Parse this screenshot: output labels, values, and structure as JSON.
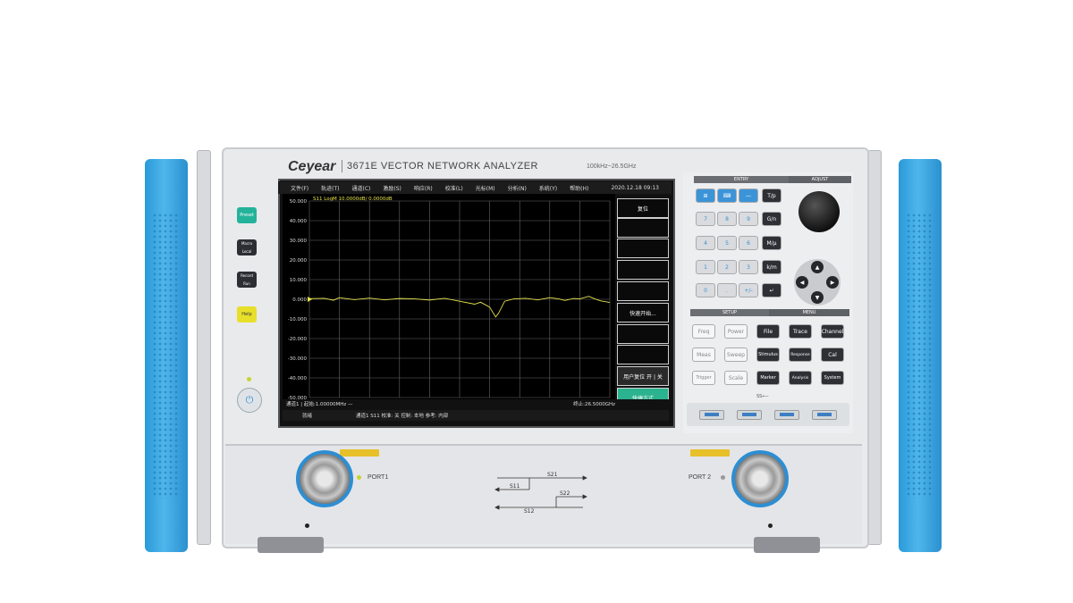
{
  "device": {
    "brand": "Ceyear",
    "model": "3671E VECTOR NETWORK ANALYZER",
    "freq_range": "100kHz~26.5GHz"
  },
  "side_buttons": {
    "preset": "Preset",
    "macro_local": "Macro Local",
    "record_run": "Record Run",
    "help": "Help"
  },
  "screen": {
    "menu": [
      "文件(F)",
      "轨迹(T)",
      "通道(C)",
      "激励(S)",
      "响应(R)",
      "校准(L)",
      "光标(M)",
      "分析(N)",
      "系统(Y)",
      "帮助(H)"
    ],
    "datetime": "2020.12.18 09:13",
    "trace_label": "S11 LogM 10.0000dB/ 0.0000dB",
    "y_ticks": [
      "50.000",
      "40.000",
      "30.000",
      "20.000",
      "10.000",
      "0.000",
      "-10.000",
      "-20.000",
      "-30.000",
      "-40.000",
      "-50.000"
    ],
    "softkeys": [
      "复位",
      "",
      "",
      "",
      "",
      "快速开始...",
      "",
      "",
      "用户复位 开 | 关",
      "快捷方式"
    ],
    "status_top": "通道1 | 起始:1.00000MHz —",
    "status_stop": "终止:26.5000GHz",
    "status_left": "就绪",
    "status_mid": "通道1  S11  校准: 关  控制: 本地  参考: 内部"
  },
  "keypad": {
    "entry_label": "ENTRY",
    "adjust_label": "ADJUST",
    "setup_label": "SETUP",
    "menu_label": "MENU",
    "entry_keys": [
      "T/p",
      "G/n",
      "M/μ",
      "k/m",
      "7",
      "8",
      "9",
      "4",
      "5",
      "6",
      "1",
      "2",
      "3",
      "0",
      "."
    ],
    "setup_keys": [
      "Freq",
      "Power",
      "Meas",
      "Sweep",
      "Trigger",
      "Scale"
    ],
    "menu_keys": [
      "File",
      "Trace",
      "Channel",
      "Stimulus",
      "Response",
      "Cal",
      "Marker",
      "Analysis",
      "System"
    ],
    "usb_label": "SS⟵"
  },
  "ports": {
    "port1": "PORT1",
    "port2": "PORT 2",
    "diagram": {
      "s21": "S21",
      "s11": "S11",
      "s22": "S22",
      "s12": "S12"
    }
  },
  "chart_data": {
    "type": "line",
    "ylabel": "",
    "ylim": [
      -50,
      50
    ],
    "xlim": [
      0,
      100
    ],
    "grid": true,
    "series": [
      {
        "values": [
          [
            0,
            0.3
          ],
          [
            5,
            0.5
          ],
          [
            8,
            -0.5
          ],
          [
            10,
            0.8
          ],
          [
            15,
            -0.2
          ],
          [
            20,
            0.6
          ],
          [
            25,
            -0.3
          ],
          [
            30,
            0.4
          ],
          [
            35,
            0.2
          ],
          [
            40,
            -0.4
          ],
          [
            45,
            0.5
          ],
          [
            50,
            -1.0
          ],
          [
            55,
            -2.5
          ],
          [
            57,
            -1.5
          ],
          [
            60,
            -4.0
          ],
          [
            62,
            -9.0
          ],
          [
            63,
            -7.0
          ],
          [
            65,
            -1.0
          ],
          [
            68,
            0.2
          ],
          [
            72,
            0.5
          ],
          [
            76,
            -0.3
          ],
          [
            80,
            0.8
          ],
          [
            83,
            0.2
          ],
          [
            85,
            -0.6
          ],
          [
            88,
            0.4
          ],
          [
            90,
            0.2
          ],
          [
            93,
            1.5
          ],
          [
            95,
            0.2
          ],
          [
            97,
            -0.8
          ],
          [
            100,
            -1.6
          ]
        ]
      }
    ]
  }
}
